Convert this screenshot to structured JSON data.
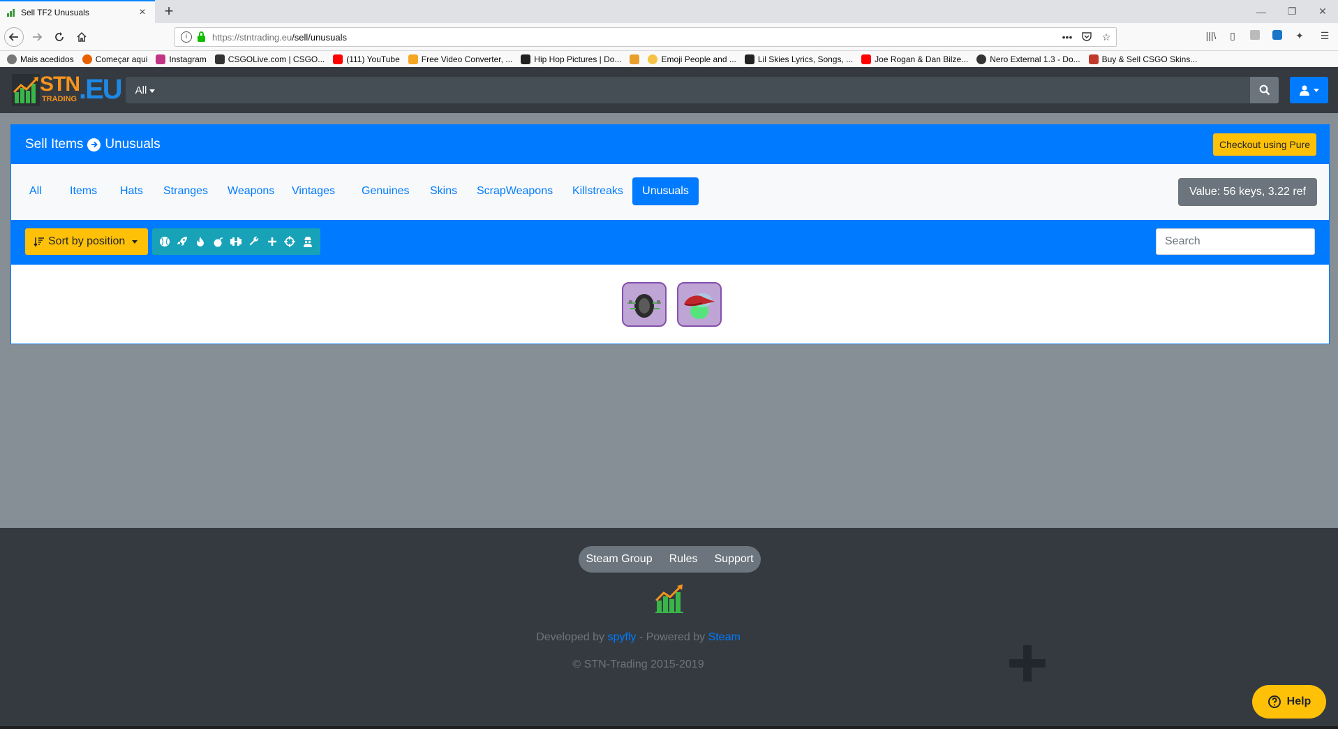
{
  "browser": {
    "tab_title": "Sell TF2 Unusuals",
    "url_domain": "https://stntrading.eu",
    "url_path": "/sell/unusuals",
    "bookmarks": [
      {
        "label": "Mais acedidos",
        "color": "#555555"
      },
      {
        "label": "Começar aqui",
        "color": "#e66000"
      },
      {
        "label": "Instagram",
        "color": "#c13584"
      },
      {
        "label": "CSGOLive.com | CSGO...",
        "color": "#333333"
      },
      {
        "label": "(111) YouTube",
        "color": "#ff0000"
      },
      {
        "label": "Free Video Converter, ...",
        "color": "#f5a623"
      },
      {
        "label": "Hip Hop Pictures | Do...",
        "color": "#222222"
      },
      {
        "label": "",
        "color": "#e8a02d"
      },
      {
        "label": "Emoji People and ...",
        "color": "#f6c243"
      },
      {
        "label": "Lil Skies Lyrics, Songs, ...",
        "color": "#222222"
      },
      {
        "label": "Joe Rogan & Dan Bilze...",
        "color": "#ff0000"
      },
      {
        "label": "Nero External 1.3 - Do...",
        "color": "#333333"
      },
      {
        "label": "Buy & Sell CSGO Skins...",
        "color": "#c0392b"
      }
    ]
  },
  "header": {
    "logo_text": "STN",
    "logo_sub": "TRADING",
    "logo_eu": ".EU",
    "search_category": "All"
  },
  "card": {
    "breadcrumb_parent": "Sell Items",
    "breadcrumb_current": "Unusuals",
    "checkout_label": "Checkout using Pure",
    "tabs": [
      "All",
      "Items",
      "Hats",
      "Stranges",
      "Weapons",
      "Vintages",
      "Genuines",
      "Skins",
      "ScrapWeapons",
      "Killstreaks",
      "Unusuals"
    ],
    "active_tab": "Unusuals",
    "value_label": "Value: 56 keys, 3.22 ref",
    "sort_label": "Sort by position",
    "search_placeholder": "Search",
    "filter_icons": [
      "baseball-icon",
      "rocket-icon",
      "flame-icon",
      "bomb-icon",
      "dumbbell-icon",
      "wrench-icon",
      "plus-icon",
      "crosshair-icon",
      "spy-icon"
    ]
  },
  "footer": {
    "links": [
      "Steam Group",
      "Rules",
      "Support"
    ],
    "developed_prefix": "Developed by",
    "developer": "spyfly",
    "powered_prefix": "- Powered by",
    "powered_by": "Steam",
    "copyright": "© STN-Trading 2015-2019",
    "help_label": "Help"
  },
  "colors": {
    "primary": "#007bff",
    "warning": "#ffc107",
    "info": "#17a2b8",
    "dark": "#343a40",
    "unusual": "#8650ac"
  }
}
